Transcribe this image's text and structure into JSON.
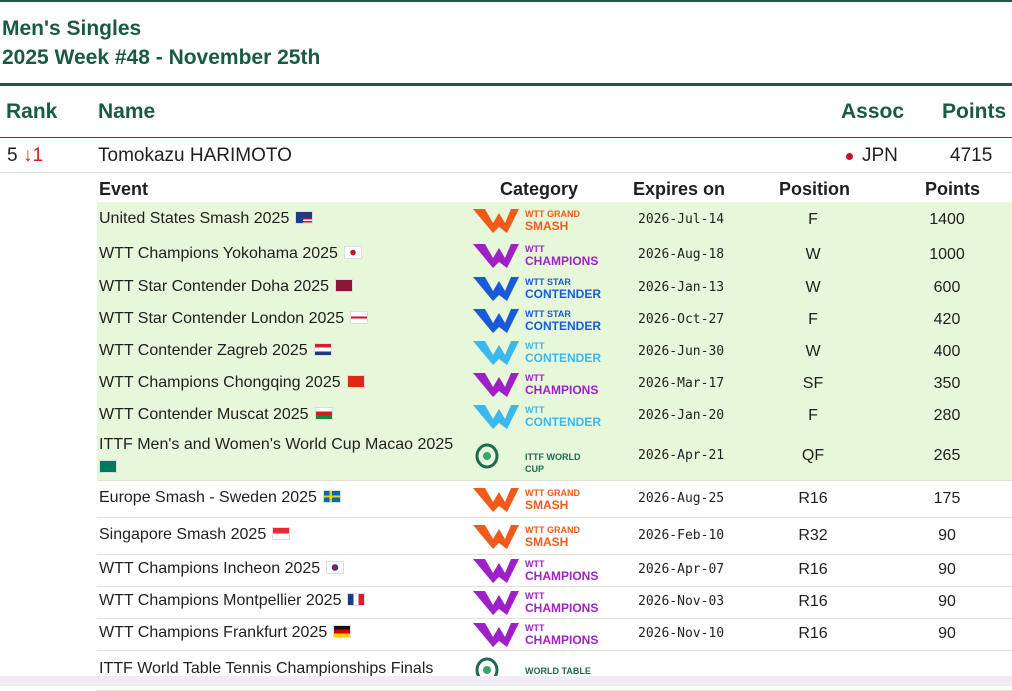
{
  "title": {
    "line1": "Men's Singles",
    "line2": "2025 Week #48 - November 25th"
  },
  "columns": {
    "rank": "Rank",
    "name": "Name",
    "assoc": "Assoc",
    "points": "Points"
  },
  "player": {
    "rank": "5",
    "rank_change": "↓1",
    "name": "Tomokazu HARIMOTO",
    "assoc": "JPN",
    "points": "4715"
  },
  "event_columns": {
    "event": "Event",
    "category": "Category",
    "expires": "Expires on",
    "position": "Position",
    "points": "Points"
  },
  "colors": {
    "accent": "#1a5a45",
    "counted_row": "#e7f8da",
    "rank_down": "#d02020"
  },
  "events": [
    {
      "name": "United States Smash 2025",
      "flag": "flag-us-icon",
      "category": "smash",
      "expires": "2026-Jul-14",
      "position": "F",
      "points": "1400",
      "counted": true
    },
    {
      "name": "WTT Champions Yokohama 2025",
      "flag": "flag-jp-icon",
      "category": "champions",
      "expires": "2026-Aug-18",
      "position": "W",
      "points": "1000",
      "counted": true
    },
    {
      "name": "WTT Star Contender Doha 2025",
      "flag": "flag-qa-icon",
      "category": "star-contender",
      "expires": "2026-Jan-13",
      "position": "W",
      "points": "600",
      "counted": true
    },
    {
      "name": "WTT Star Contender London 2025",
      "flag": "flag-en-icon",
      "category": "star-contender",
      "expires": "2026-Oct-27",
      "position": "F",
      "points": "420",
      "counted": true
    },
    {
      "name": "WTT Contender Zagreb 2025",
      "flag": "flag-hr-icon",
      "category": "contender",
      "expires": "2026-Jun-30",
      "position": "W",
      "points": "400",
      "counted": true
    },
    {
      "name": "WTT Champions Chongqing 2025",
      "flag": "flag-cn-icon",
      "category": "champions",
      "expires": "2026-Mar-17",
      "position": "SF",
      "points": "350",
      "counted": true
    },
    {
      "name": "WTT Contender Muscat 2025",
      "flag": "flag-om-icon",
      "category": "contender",
      "expires": "2026-Jan-20",
      "position": "F",
      "points": "280",
      "counted": true
    },
    {
      "name": "ITTF Men's and Women's World Cup Macao 2025",
      "flag": "flag-mo-icon",
      "category": "world-cup",
      "expires": "2026-Apr-21",
      "position": "QF",
      "points": "265",
      "counted": true
    },
    {
      "name": "Europe Smash - Sweden 2025",
      "flag": "flag-se-icon",
      "category": "smash",
      "expires": "2026-Aug-25",
      "position": "R16",
      "points": "175",
      "counted": false
    },
    {
      "name": "Singapore Smash 2025",
      "flag": "flag-sg-icon",
      "category": "smash",
      "expires": "2026-Feb-10",
      "position": "R32",
      "points": "90",
      "counted": false
    },
    {
      "name": "WTT Champions Incheon 2025",
      "flag": "flag-kr-icon",
      "category": "champions",
      "expires": "2026-Apr-07",
      "position": "R16",
      "points": "90",
      "counted": false
    },
    {
      "name": "WTT Champions Montpellier 2025",
      "flag": "flag-fr-icon",
      "category": "champions",
      "expires": "2026-Nov-03",
      "position": "R16",
      "points": "90",
      "counted": false
    },
    {
      "name": "WTT Champions Frankfurt 2025",
      "flag": "flag-de-icon",
      "category": "champions",
      "expires": "2026-Nov-10",
      "position": "R16",
      "points": "90",
      "counted": false
    },
    {
      "name": "ITTF World Table Tennis Championships Finals",
      "flag": "",
      "category": "wttc",
      "expires": "",
      "position": "",
      "points": "",
      "counted": false
    }
  ],
  "category_logos": {
    "smash": {
      "line1": "WTT GRAND",
      "line2": "SMASH",
      "color": "#f05a1a"
    },
    "champions": {
      "line1": "WTT",
      "line2": "CHAMPIONS",
      "color": "#a020c8"
    },
    "star-contender": {
      "line1": "WTT STAR",
      "line2": "CONTENDER",
      "color": "#1a5ad8"
    },
    "contender": {
      "line1": "WTT",
      "line2": "CONTENDER",
      "color": "#3ab8f0"
    },
    "world-cup": {
      "line1": "ITTF WORLD CUP",
      "line2": "",
      "color": "#1d6b50"
    },
    "wttc": {
      "line1": "WORLD TABLE TENNIS",
      "line2": "",
      "color": "#1d6b50"
    }
  }
}
